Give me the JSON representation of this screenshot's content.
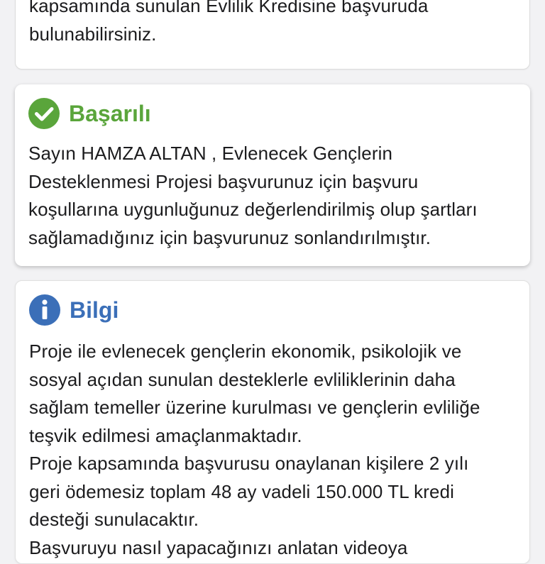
{
  "colors": {
    "success": "#5aa53b",
    "info": "#3b6fb8",
    "text": "#1c1c1e"
  },
  "intro_card": {
    "lines": [
      "kapsamında sunulan Evlilik Kredisine başvuruda",
      "bulunabilirsiniz."
    ]
  },
  "success_card": {
    "icon": "check-circle-icon",
    "title": "Başarılı",
    "lines": [
      "Sayın HAMZA ALTAN , Evlenecek Gençlerin",
      "Desteklenmesi Projesi başvurunuz için başvuru",
      "koşullarına uygunluğunuz değerlendirilmiş olup şartları",
      "sağlamadığınız için başvurunuz sonlandırılmıştır."
    ]
  },
  "info_card": {
    "icon": "info-circle-icon",
    "title": "Bilgi",
    "lines": [
      "Proje ile evlenecek gençlerin ekonomik, psikolojik ve",
      "sosyal açıdan sunulan desteklerle evliliklerinin daha",
      "sağlam temeller üzerine kurulması ve gençlerin evliliğe",
      "teşvik edilmesi amaçlanmaktadır.",
      "Proje kapsamında başvurusu onaylanan kişilere 2 yılı",
      "geri ödemesiz toplam 48 ay vadeli 150.000 TL kredi",
      "desteği sunulacaktır.",
      "Başvuruyu nasıl yapacağınızı anlatan videoya"
    ]
  }
}
